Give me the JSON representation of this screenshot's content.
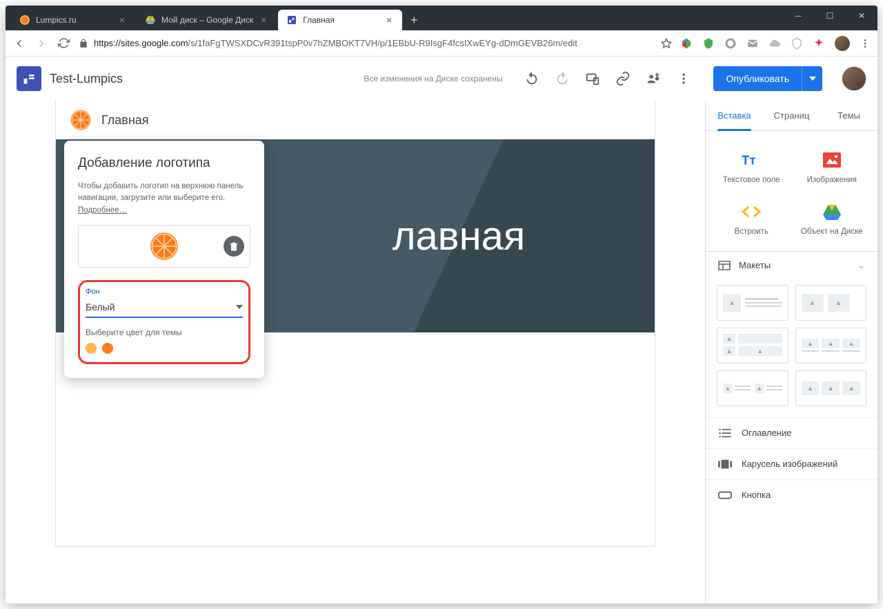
{
  "browser": {
    "tabs": [
      {
        "title": "Lumpics.ru",
        "favicon": "orange"
      },
      {
        "title": "Мой диск – Google Диск",
        "favicon": "drive"
      },
      {
        "title": "Главная",
        "favicon": "sites",
        "active": true
      }
    ],
    "url_host": "https://sites.google.com",
    "url_path": "/s/1faFgTWSXDCvR391tspP0v7hZMBOKT7VH/p/1EBbU-R9IsgF4fcsIXwEYg-dDmGEVB26m/edit"
  },
  "app": {
    "title": "Test-Lumpics",
    "save_status": "Все изменения на Диске сохранены",
    "publish": "Опубликовать"
  },
  "site": {
    "page_name": "Главная",
    "hero_text": "лавная"
  },
  "popup": {
    "title": "Добавление логотипа",
    "desc_text": "Чтобы добавить логотип на верхнюю панель навигации, загрузите или выберите его. ",
    "desc_link": "Подробнее…",
    "field_label": "Фон",
    "select_value": "Белый",
    "color_label": "Выберите цвет для темы"
  },
  "side": {
    "tabs": [
      "Вставка",
      "Страниц",
      "Темы"
    ],
    "insert_items": [
      {
        "label": "Текстовое поле",
        "icon": "text"
      },
      {
        "label": "Изображения",
        "icon": "image"
      },
      {
        "label": "Встроить",
        "icon": "embed"
      },
      {
        "label": "Объект на Диске",
        "icon": "drive"
      }
    ],
    "layouts_header": "Макеты",
    "options": [
      {
        "label": "Оглавление",
        "icon": "toc"
      },
      {
        "label": "Карусель изображений",
        "icon": "carousel"
      },
      {
        "label": "Кнопка",
        "icon": "button"
      }
    ]
  }
}
